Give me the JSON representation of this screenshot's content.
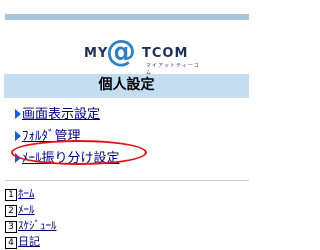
{
  "logo": {
    "my": "MY",
    "at": "@",
    "tcom": "TCOM",
    "tagline": "マイアットティーコム"
  },
  "page_title": "個人設定",
  "menu": [
    {
      "label": "画面表示設定"
    },
    {
      "label": "ﾌｫﾙﾀﾞ管理"
    },
    {
      "label": "ﾒｰﾙ振り分け設定"
    }
  ],
  "shortcuts": [
    {
      "key": "1",
      "label": "ﾎｰﾑ"
    },
    {
      "key": "2",
      "label": "ﾒｰﾙ"
    },
    {
      "key": "3",
      "label": "ｽｹｼﾞｭｰﾙ"
    },
    {
      "key": "4",
      "label": "日記"
    }
  ],
  "colors": {
    "title_bar": "#c5ddf1",
    "link": "#000080",
    "highlight": "#e0151b",
    "accent": "#2e7fc6"
  }
}
